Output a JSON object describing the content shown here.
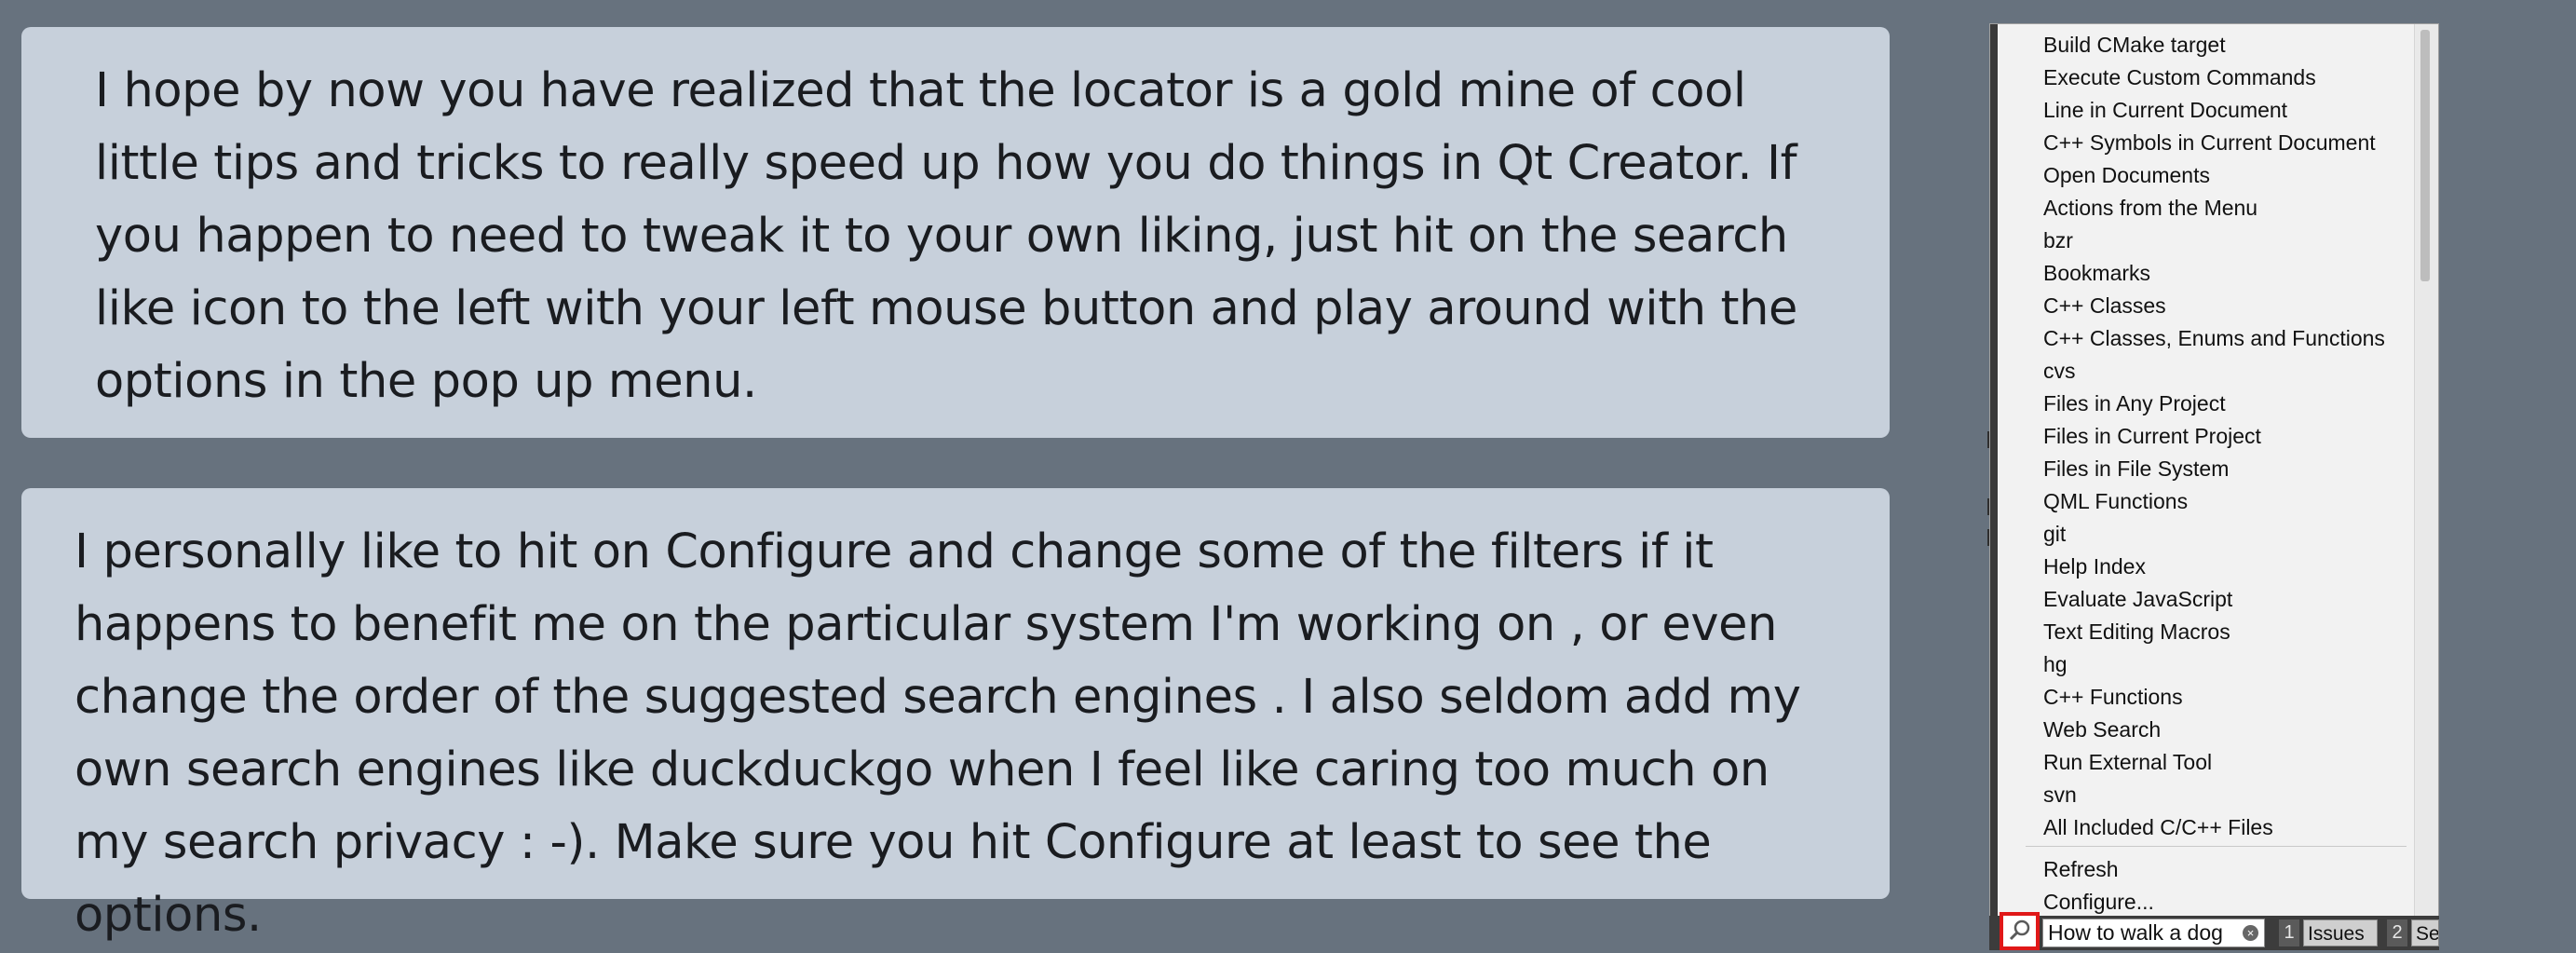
{
  "cards": [
    {
      "text": "I hope by now you have realized that the locator is a gold mine of cool little tips and tricks to really speed up how you do things in Qt Creator. If you happen to need to tweak it to your own liking, just hit on the search like icon to the left with your left mouse button and play around with the options in the pop up menu."
    },
    {
      "text": "I personally like to hit on Configure and change some of the filters if it happens to benefit me on the particular system I'm working on , or even change the order of the suggested search engines . I also seldom add my own search engines like duckduckgo when I feel like caring too much on my search privacy : -). Make sure you hit Configure at least to see the options."
    }
  ],
  "locator_menu": {
    "filters": [
      "Build CMake target",
      "Execute Custom Commands",
      "Line in Current Document",
      "C++ Symbols in Current Document",
      "Open Documents",
      "Actions from the Menu",
      "bzr",
      "Bookmarks",
      "C++ Classes",
      "C++ Classes, Enums and Functions",
      "cvs",
      "Files in Any Project",
      "Files in Current Project",
      "Files in File System",
      "QML Functions",
      "git",
      "Help Index",
      "Evaluate JavaScript",
      "Text Editing Macros",
      "hg",
      "C++ Functions",
      "Web Search",
      "Run External Tool",
      "svn",
      "All Included C/C++ Files"
    ],
    "refresh": "Refresh",
    "configure": "Configure..."
  },
  "status_bar": {
    "search_icon": "magnifier-icon",
    "locator_value": "How to walk a dog",
    "clear_icon": "clear-icon",
    "panes": [
      {
        "number": "1",
        "label": "Issues"
      },
      {
        "number": "2",
        "label": "Se"
      }
    ]
  },
  "colors": {
    "background": "#67727e",
    "card": "#c7d0db",
    "highlight": "#e01818"
  }
}
